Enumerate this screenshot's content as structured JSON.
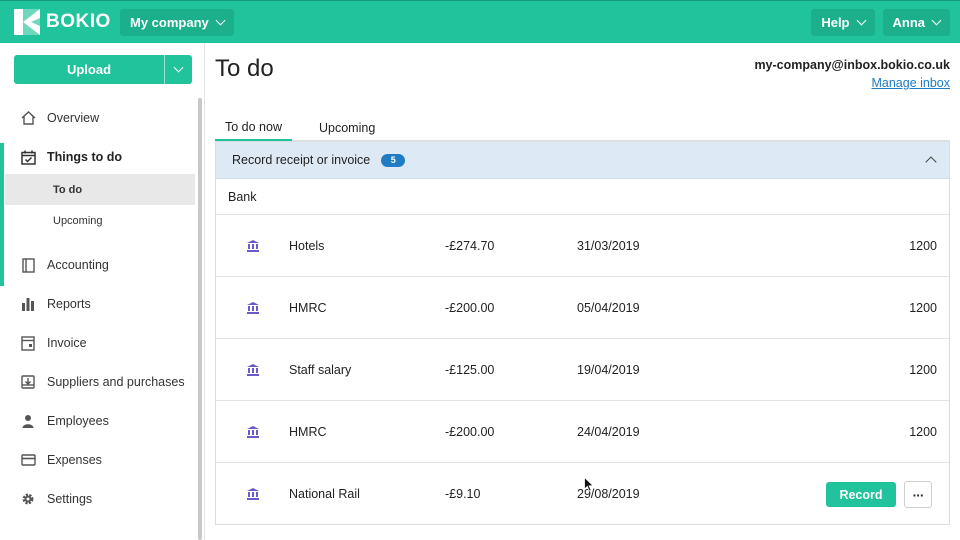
{
  "topbar": {
    "brand": "BOKIO",
    "company": "My company",
    "help": "Help",
    "user": "Anna",
    "accent": "#20c39b"
  },
  "sidebar": {
    "upload_label": "Upload",
    "items": [
      {
        "label": "Overview",
        "icon": "home-icon"
      },
      {
        "label": "Things to do",
        "icon": "calendar-check-icon"
      },
      {
        "label": "Accounting",
        "icon": "book-icon"
      },
      {
        "label": "Reports",
        "icon": "bar-chart-icon"
      },
      {
        "label": "Invoice",
        "icon": "invoice-icon"
      },
      {
        "label": "Suppliers and purchases",
        "icon": "inbox-download-icon"
      },
      {
        "label": "Employees",
        "icon": "person-icon"
      },
      {
        "label": "Expenses",
        "icon": "card-icon"
      },
      {
        "label": "Settings",
        "icon": "gear-icon"
      }
    ],
    "sub_items": [
      {
        "label": "To do"
      },
      {
        "label": "Upcoming"
      }
    ]
  },
  "main": {
    "title": "To do",
    "inbox_email": "my-company@inbox.bokio.co.uk",
    "manage_inbox": "Manage inbox",
    "tabs": [
      {
        "label": "To do now"
      },
      {
        "label": "Upcoming"
      }
    ],
    "section": {
      "title": "Record receipt or invoice",
      "count": "5",
      "group": "Bank"
    },
    "rows": [
      {
        "name": "Hotels",
        "amount": "-£274.70",
        "date": "31/03/2019",
        "account": "1200"
      },
      {
        "name": "HMRC",
        "amount": "-£200.00",
        "date": "05/04/2019",
        "account": "1200"
      },
      {
        "name": "Staff salary",
        "amount": "-£125.00",
        "date": "19/04/2019",
        "account": "1200"
      },
      {
        "name": "HMRC",
        "amount": "-£200.00",
        "date": "24/04/2019",
        "account": "1200"
      },
      {
        "name": "National Rail",
        "amount": "-£9.10",
        "date": "29/08/2019",
        "record_label": "Record",
        "more_label": "···"
      }
    ]
  }
}
